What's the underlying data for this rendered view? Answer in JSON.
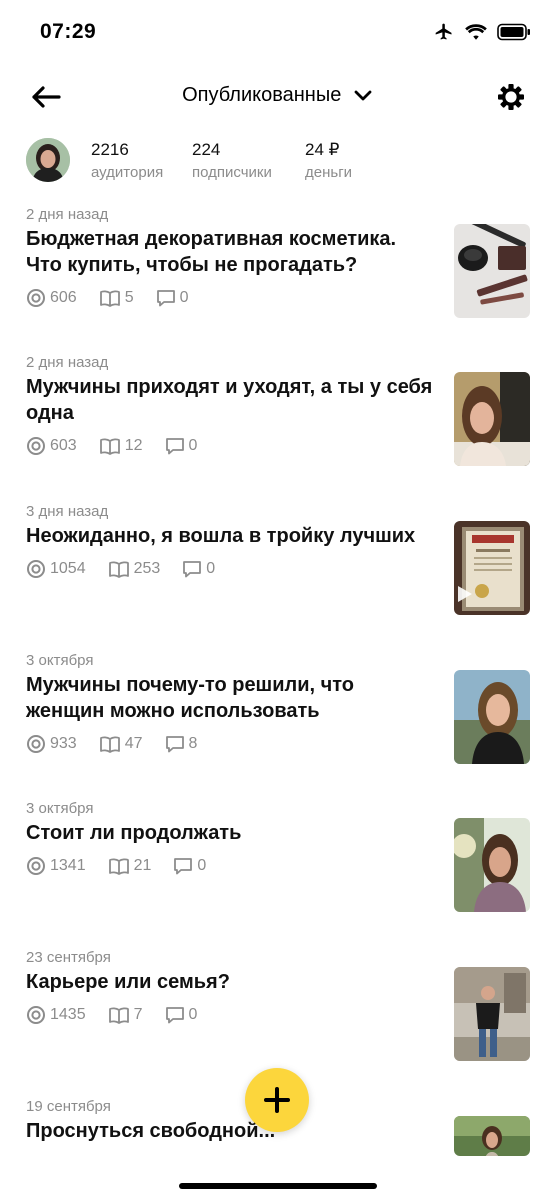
{
  "status_bar": {
    "time": "07:29"
  },
  "nav": {
    "title": "Опубликованные"
  },
  "profile": {
    "stats": [
      {
        "value": "2216",
        "label": "аудитория"
      },
      {
        "value": "224",
        "label": "подписчики"
      },
      {
        "value": "24 ₽",
        "label": "деньги"
      }
    ]
  },
  "posts": [
    {
      "date": "2 дня назад",
      "title": "Бюджетная декоративная косметика. Что купить, чтобы не прогадать?",
      "views": "606",
      "reads": "5",
      "comments": "0"
    },
    {
      "date": "2 дня назад",
      "title": "Мужчины приходят и уходят, а ты у себя одна",
      "views": "603",
      "reads": "12",
      "comments": "0"
    },
    {
      "date": "3 дня назад",
      "title": "Неожиданно, я вошла в тройку лучших",
      "views": "1054",
      "reads": "253",
      "comments": "0"
    },
    {
      "date": "3 октября",
      "title": "Мужчины почему-то решили, что женщин можно использовать",
      "views": "933",
      "reads": "47",
      "comments": "8"
    },
    {
      "date": "3 октября",
      "title": "Стоит ли продолжать",
      "views": "1341",
      "reads": "21",
      "comments": "0"
    },
    {
      "date": "23 сентября",
      "title": "Карьере или семья?",
      "views": "1435",
      "reads": "7",
      "comments": "0"
    },
    {
      "date": "19 сентября",
      "title": "Проснуться свободной...",
      "views": "",
      "reads": "",
      "comments": ""
    }
  ],
  "colors": {
    "fab": "#fcd63c",
    "secondary_text": "#8c8c8c"
  }
}
